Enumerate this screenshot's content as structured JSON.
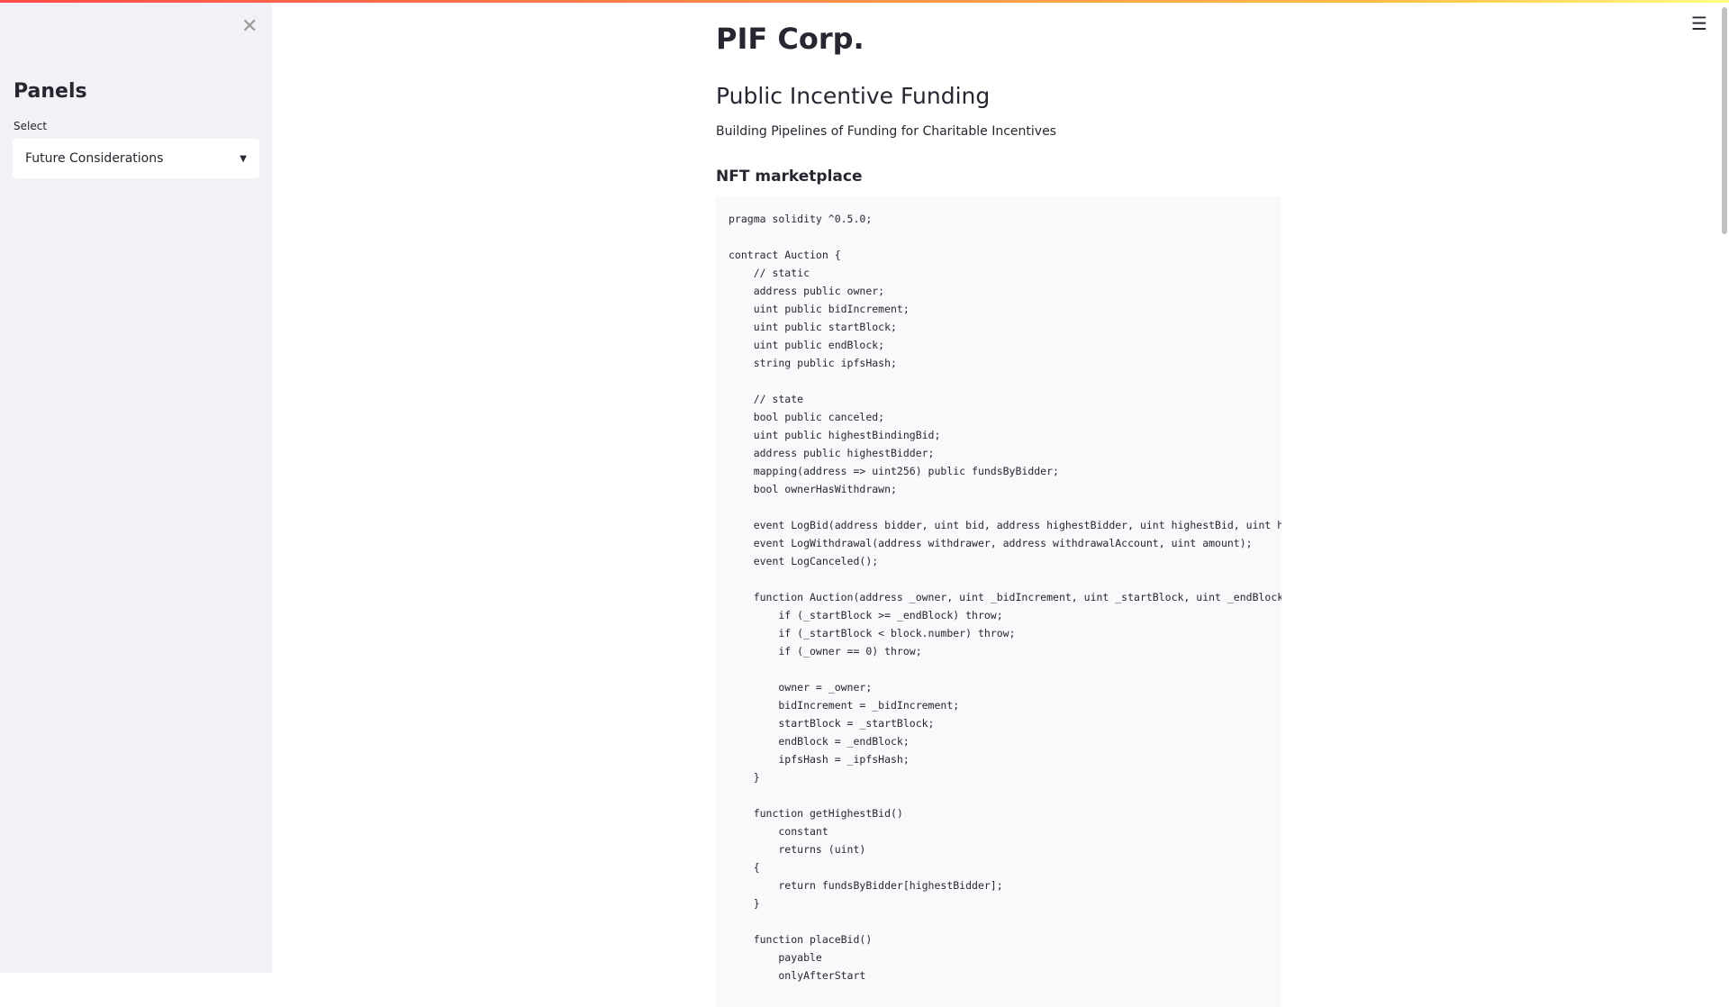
{
  "sidebar": {
    "close_icon": "close-icon",
    "title": "Panels",
    "select_label": "Select",
    "select_value": "Future Considerations"
  },
  "header": {
    "menu_icon": "hamburger-icon"
  },
  "main": {
    "title": "PIF Corp.",
    "subtitle": "Public Incentive Funding",
    "tagline": "Building Pipelines of Funding for Charitable Incentives",
    "section": "NFT marketplace",
    "code_lines": [
      "pragma solidity ^0.5.0;",
      "",
      "contract Auction {",
      "    // static",
      "    address public owner;",
      "    uint public bidIncrement;",
      "    uint public startBlock;",
      "    uint public endBlock;",
      "    string public ipfsHash;",
      "",
      "    // state",
      "    bool public canceled;",
      "    uint public highestBindingBid;",
      "    address public highestBidder;",
      "    mapping(address => uint256) public fundsByBidder;",
      "    bool ownerHasWithdrawn;",
      "",
      "    event LogBid(address bidder, uint bid, address highestBidder, uint highestBid, uint highestBindingBid);",
      "    event LogWithdrawal(address withdrawer, address withdrawalAccount, uint amount);",
      "    event LogCanceled();",
      "",
      "    function Auction(address _owner, uint _bidIncrement, uint _startBlock, uint _endBlock, string _ipfsHash) {",
      "        if (_startBlock >= _endBlock) throw;",
      "        if (_startBlock < block.number) throw;",
      "        if (_owner == 0) throw;",
      "",
      "        owner = _owner;",
      "        bidIncrement = _bidIncrement;",
      "        startBlock = _startBlock;",
      "        endBlock = _endBlock;",
      "        ipfsHash = _ipfsHash;",
      "    }",
      "",
      "    function getHighestBid()",
      "        constant",
      "        returns (uint)",
      "    {",
      "        return fundsByBidder[highestBidder];",
      "    }",
      "",
      "    function placeBid()",
      "        payable",
      "        onlyAfterStart"
    ]
  }
}
